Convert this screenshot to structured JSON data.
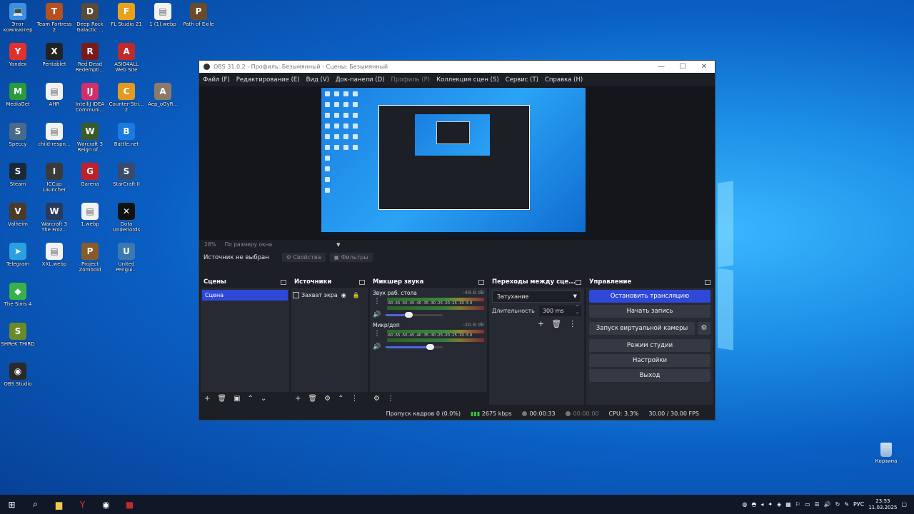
{
  "desktop": {
    "icons": [
      {
        "label": "Этот компьютер",
        "color": "#3d8fe0",
        "glyph": "💻"
      },
      {
        "label": "Team Fortress 2",
        "color": "#b5501f",
        "glyph": "T"
      },
      {
        "label": "Deep Rock Galactic ...",
        "color": "#5a4a3a",
        "glyph": "D"
      },
      {
        "label": "FL Studio 21",
        "color": "#e8a21a",
        "glyph": "F"
      },
      {
        "label": "1 (1).webp",
        "color": "#f2f2f2",
        "glyph": "▤"
      },
      {
        "label": "Path of Exile",
        "color": "#6b4a2a",
        "glyph": "P"
      },
      {
        "label": "Yandex",
        "color": "#e0312d",
        "glyph": "Y"
      },
      {
        "label": "Pentablet",
        "color": "#222222",
        "glyph": "X"
      },
      {
        "label": "Red Dead Redempti...",
        "color": "#7a1a1a",
        "glyph": "R"
      },
      {
        "label": "ASIO4ALL Web Site",
        "color": "#c02a2a",
        "glyph": "A"
      },
      {
        "label": "MediaGet",
        "color": "#2a9a3a",
        "glyph": "M"
      },
      {
        "label": "AHR",
        "color": "#f2f2f2",
        "glyph": "▤"
      },
      {
        "label": "IntelliJ IDEA Communi...",
        "color": "#d0306a",
        "glyph": "IJ"
      },
      {
        "label": "Counter-Stri... 2",
        "color": "#e09a20",
        "glyph": "C"
      },
      {
        "label": "Aep_oGyR...",
        "color": "#8a7a6a",
        "glyph": "A"
      },
      {
        "label": "Speccy",
        "color": "#4a6a8a",
        "glyph": "S"
      },
      {
        "label": "child-respn...",
        "color": "#f2f2f2",
        "glyph": "▤"
      },
      {
        "label": "Warcraft 3 Reign of...",
        "color": "#3a5a2a",
        "glyph": "W"
      },
      {
        "label": "Battle.net",
        "color": "#1a7ae0",
        "glyph": "B"
      },
      {
        "label": "Steam",
        "color": "#1b2838",
        "glyph": "S"
      },
      {
        "label": "ICCup Launcher",
        "color": "#3a3a3a",
        "glyph": "I"
      },
      {
        "label": "Garena",
        "color": "#c0202a",
        "glyph": "G"
      },
      {
        "label": "StarCraft II",
        "color": "#3a4a6a",
        "glyph": "S"
      },
      {
        "label": "Valheim",
        "color": "#4a3a2a",
        "glyph": "V"
      },
      {
        "label": "Warcraft 3 The Froz...",
        "color": "#2a3a5a",
        "glyph": "W"
      },
      {
        "label": "1.webp",
        "color": "#f2f2f2",
        "glyph": "▤"
      },
      {
        "label": "Dota Underlords",
        "color": "#111111",
        "glyph": "✕"
      },
      {
        "label": "Telegram",
        "color": "#2aa0e0",
        "glyph": "➤"
      },
      {
        "label": "XXL.webp",
        "color": "#f2f2f2",
        "glyph": "▤"
      },
      {
        "label": "Project Zomboid",
        "color": "#8a5a2a",
        "glyph": "P"
      },
      {
        "label": "United Pengui...",
        "color": "#3a7ab0",
        "glyph": "U"
      },
      {
        "label": "The Sims 4",
        "color": "#3ab04a",
        "glyph": "◆"
      },
      {
        "label": "SHReK THIRD",
        "color": "#6a8a2a",
        "glyph": "S"
      },
      {
        "label": "OBS Studio",
        "color": "#2a2a2a",
        "glyph": "◉"
      }
    ],
    "trash_label": "Корзина"
  },
  "obs": {
    "title": "OBS 31.0.2 - Профиль: Безымянный - Сцены: Безымянный",
    "menu": [
      {
        "label": "Файл (F)",
        "enabled": true
      },
      {
        "label": "Редактирование (E)",
        "enabled": true
      },
      {
        "label": "Вид (V)",
        "enabled": true
      },
      {
        "label": "Док-панели (D)",
        "enabled": true
      },
      {
        "label": "Профиль (P)",
        "enabled": false
      },
      {
        "label": "Коллекция сцен (S)",
        "enabled": true
      },
      {
        "label": "Сервис (T)",
        "enabled": true
      },
      {
        "label": "Справка (H)",
        "enabled": true
      }
    ],
    "zoom_label": "28%",
    "fit_label": "По размеру окна",
    "source_status": "Источник не выбран",
    "properties_label": "Свойства",
    "filters_label": "Фильтры",
    "scenes": {
      "title": "Сцены",
      "items": [
        "Сцена"
      ]
    },
    "sources": {
      "title": "Источники",
      "items": [
        "Захват экра"
      ]
    },
    "mixer": {
      "title": "Микшер звука",
      "ticks": "-60 -55 -50 -45 -40 -35 -30 -25 -20 -15 -10 -5 0",
      "channels": [
        {
          "name": "Звук раб. стола",
          "db": "-49.8 dB",
          "volume": 0.4
        },
        {
          "name": "Микр/доп",
          "db": "-20.8 dB",
          "volume": 0.78
        }
      ]
    },
    "transitions": {
      "title": "Переходы между сце...",
      "selected": "Затухание",
      "duration_label": "Длительность",
      "duration_value": "300 ms"
    },
    "controls": {
      "title": "Управление",
      "stop_stream": "Остановить трансляцию",
      "start_record": "Начать запись",
      "virtual_cam": "Запуск виртуальной камеры",
      "studio_mode": "Режим студии",
      "settings": "Настройки",
      "exit": "Выход"
    },
    "status": {
      "dropped": "Пропуск кадров 0 (0.0%)",
      "bitrate": "2675 kbps",
      "stream_time": "00:00:33",
      "record_time": "00:00:00",
      "cpu": "CPU: 3.3%",
      "fps": "30.00 / 30.00 FPS"
    }
  },
  "taskbar": {
    "lang": "РУС",
    "time": "23:53",
    "date": "11.03.2025"
  },
  "colors": {
    "accent": "#2e48d8",
    "panel": "#272a33",
    "window": "#1d1f26"
  }
}
